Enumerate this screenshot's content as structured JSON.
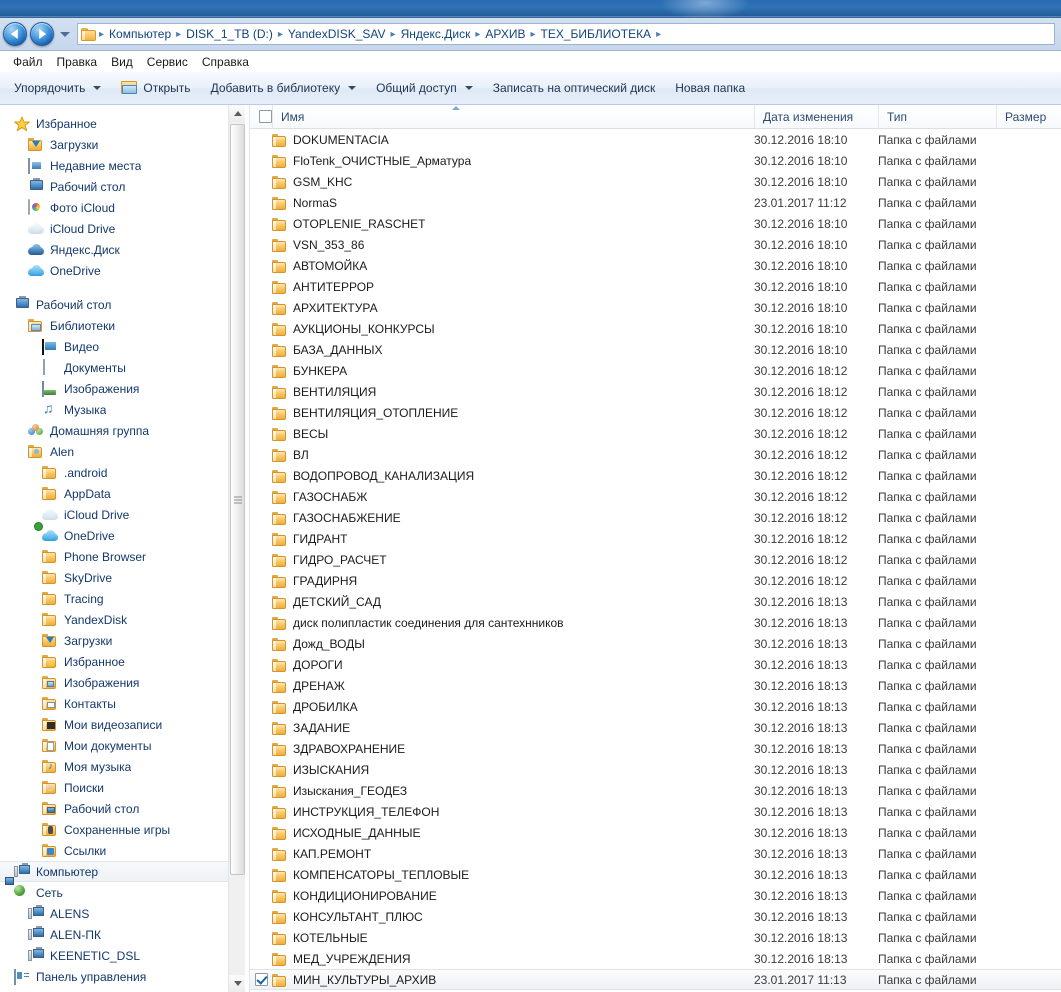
{
  "window": {
    "nav": {
      "back_tooltip": "Назад",
      "forward_tooltip": "Вперед",
      "history_tooltip": "Последние страницы"
    },
    "breadcrumb": [
      "Компьютер",
      "DISK_1_TB (D:)",
      "YandexDISK_SAV",
      "Яндекс.Диск",
      "АРХИВ",
      "ТЕХ_БИБЛИОТЕКА"
    ],
    "breadcrumb_separator": "▸"
  },
  "menubar": {
    "items": [
      {
        "label": "Файл"
      },
      {
        "label": "Правка"
      },
      {
        "label": "Вид"
      },
      {
        "label": "Сервис"
      },
      {
        "label": "Справка"
      }
    ]
  },
  "toolbar": {
    "buttons": [
      {
        "label": "Упорядочить",
        "icon": "none",
        "has_caret": true
      },
      {
        "label": "Открыть",
        "icon": "open-folder-icon",
        "has_caret": false
      },
      {
        "label": "Добавить в библиотеку",
        "icon": "none",
        "has_caret": true
      },
      {
        "label": "Общий доступ",
        "icon": "none",
        "has_caret": true
      },
      {
        "label": "Записать на оптический диск",
        "icon": "none",
        "has_caret": false
      },
      {
        "label": "Новая папка",
        "icon": "none",
        "has_caret": false
      }
    ]
  },
  "sidebar": {
    "items": [
      {
        "label": "Избранное",
        "icon": "star-icon",
        "indent": 0
      },
      {
        "label": "Загрузки",
        "icon": "downloads-icon",
        "indent": 1
      },
      {
        "label": "Недавние места",
        "icon": "recent-icon",
        "indent": 1
      },
      {
        "label": "Рабочий стол",
        "icon": "desktop-icon",
        "indent": 1
      },
      {
        "label": "Фото iCloud",
        "icon": "icloud-photo-icon",
        "indent": 1
      },
      {
        "label": "iCloud Drive",
        "icon": "cloud-gray-icon",
        "indent": 1
      },
      {
        "label": "Яндекс.Диск",
        "icon": "cloud-dark-icon",
        "indent": 1
      },
      {
        "label": "OneDrive",
        "icon": "cloud-icon",
        "indent": 1
      },
      {
        "label": "",
        "icon": "spacer",
        "indent": 0
      },
      {
        "label": "Рабочий стол",
        "icon": "desktop-icon",
        "indent": 0
      },
      {
        "label": "Библиотеки",
        "icon": "libraries-icon",
        "indent": 1
      },
      {
        "label": "Видео",
        "icon": "video-icon",
        "indent": 2
      },
      {
        "label": "Документы",
        "icon": "document-icon",
        "indent": 2
      },
      {
        "label": "Изображения",
        "icon": "picture-icon",
        "indent": 2
      },
      {
        "label": "Музыка",
        "icon": "music-icon",
        "indent": 2
      },
      {
        "label": "Домашняя группа",
        "icon": "homegroup-icon",
        "indent": 1
      },
      {
        "label": "Alen",
        "icon": "user-folder-icon",
        "indent": 1
      },
      {
        "label": ".android",
        "icon": "folder-icon",
        "indent": 2
      },
      {
        "label": "AppData",
        "icon": "folder-icon",
        "indent": 2
      },
      {
        "label": "iCloud Drive",
        "icon": "cloud-gray-icon",
        "indent": 2
      },
      {
        "label": "OneDrive",
        "icon": "onedrive-sync-icon",
        "indent": 2
      },
      {
        "label": "Phone Browser",
        "icon": "folder-icon",
        "indent": 2
      },
      {
        "label": "SkyDrive",
        "icon": "folder-icon",
        "indent": 2
      },
      {
        "label": "Tracing",
        "icon": "folder-icon",
        "indent": 2
      },
      {
        "label": "YandexDisk",
        "icon": "folder-icon",
        "indent": 2
      },
      {
        "label": "Загрузки",
        "icon": "downloads-icon",
        "indent": 2
      },
      {
        "label": "Избранное",
        "icon": "fav-folder-icon",
        "indent": 2
      },
      {
        "label": "Изображения",
        "icon": "pic-folder-icon",
        "indent": 2
      },
      {
        "label": "Контакты",
        "icon": "contacts-icon",
        "indent": 2
      },
      {
        "label": "Мои видеозаписи",
        "icon": "video-folder-icon",
        "indent": 2
      },
      {
        "label": "Мои документы",
        "icon": "doc-folder-icon",
        "indent": 2
      },
      {
        "label": "Моя музыка",
        "icon": "music-folder-icon",
        "indent": 2
      },
      {
        "label": "Поиски",
        "icon": "search-folder-icon",
        "indent": 2
      },
      {
        "label": "Рабочий стол",
        "icon": "desk-folder-icon",
        "indent": 2
      },
      {
        "label": "Сохраненные игры",
        "icon": "games-folder-icon",
        "indent": 2
      },
      {
        "label": "Ссылки",
        "icon": "links-folder-icon",
        "indent": 2
      },
      {
        "label": "Компьютер",
        "icon": "computer-icon",
        "indent": 0,
        "selected": true
      },
      {
        "label": "Сеть",
        "icon": "network-icon",
        "indent": 0
      },
      {
        "label": "ALENS",
        "icon": "computer-icon",
        "indent": 1
      },
      {
        "label": "ALEN-ПК",
        "icon": "computer-icon",
        "indent": 1
      },
      {
        "label": "KEENETIC_DSL",
        "icon": "computer-icon",
        "indent": 1
      },
      {
        "label": "Панель управления",
        "icon": "control-panel-icon",
        "indent": 0
      }
    ]
  },
  "filelist": {
    "columns": [
      {
        "key": "name",
        "label": "Имя",
        "sorted": true
      },
      {
        "key": "date",
        "label": "Дата изменения",
        "sorted": false
      },
      {
        "key": "type",
        "label": "Тип",
        "sorted": false
      },
      {
        "key": "size",
        "label": "Размер",
        "sorted": false
      }
    ],
    "folder_type_label": "Папка с файлами",
    "rows": [
      {
        "name": "DOKUMENTACIA",
        "date": "30.12.2016 18:10",
        "type": "Папка с файлами",
        "size": ""
      },
      {
        "name": "FloTenk_ОЧИСТНЫЕ_Арматура",
        "date": "30.12.2016 18:10",
        "type": "Папка с файлами",
        "size": ""
      },
      {
        "name": "GSM_KHC",
        "date": "30.12.2016 18:10",
        "type": "Папка с файлами",
        "size": ""
      },
      {
        "name": "NormaS",
        "date": "23.01.2017 11:12",
        "type": "Папка с файлами",
        "size": ""
      },
      {
        "name": "OTOPLENIE_RASCHET",
        "date": "30.12.2016 18:10",
        "type": "Папка с файлами",
        "size": ""
      },
      {
        "name": "VSN_353_86",
        "date": "30.12.2016 18:10",
        "type": "Папка с файлами",
        "size": ""
      },
      {
        "name": "АВТОМОЙКА",
        "date": "30.12.2016 18:10",
        "type": "Папка с файлами",
        "size": ""
      },
      {
        "name": "АНТИТЕРРОР",
        "date": "30.12.2016 18:10",
        "type": "Папка с файлами",
        "size": ""
      },
      {
        "name": "АРХИТЕКТУРА",
        "date": "30.12.2016 18:10",
        "type": "Папка с файлами",
        "size": ""
      },
      {
        "name": "АУКЦИОНЫ_КОНКУРСЫ",
        "date": "30.12.2016 18:10",
        "type": "Папка с файлами",
        "size": ""
      },
      {
        "name": "БАЗА_ДАННЫХ",
        "date": "30.12.2016 18:10",
        "type": "Папка с файлами",
        "size": ""
      },
      {
        "name": "БУНКЕРА",
        "date": "30.12.2016 18:12",
        "type": "Папка с файлами",
        "size": ""
      },
      {
        "name": "ВЕНТИЛЯЦИЯ",
        "date": "30.12.2016 18:12",
        "type": "Папка с файлами",
        "size": ""
      },
      {
        "name": "ВЕНТИЛЯЦИЯ_ОТОПЛЕНИЕ",
        "date": "30.12.2016 18:12",
        "type": "Папка с файлами",
        "size": ""
      },
      {
        "name": "ВЕСЫ",
        "date": "30.12.2016 18:12",
        "type": "Папка с файлами",
        "size": ""
      },
      {
        "name": "ВЛ",
        "date": "30.12.2016 18:12",
        "type": "Папка с файлами",
        "size": ""
      },
      {
        "name": "ВОДОПРОВОД_КАНАЛИЗАЦИЯ",
        "date": "30.12.2016 18:12",
        "type": "Папка с файлами",
        "size": ""
      },
      {
        "name": "ГАЗОСНАБЖ",
        "date": "30.12.2016 18:12",
        "type": "Папка с файлами",
        "size": ""
      },
      {
        "name": "ГАЗОСНАБЖЕНИЕ",
        "date": "30.12.2016 18:12",
        "type": "Папка с файлами",
        "size": ""
      },
      {
        "name": "ГИДРАНТ",
        "date": "30.12.2016 18:12",
        "type": "Папка с файлами",
        "size": ""
      },
      {
        "name": "ГИДРО_РАСЧЕТ",
        "date": "30.12.2016 18:12",
        "type": "Папка с файлами",
        "size": ""
      },
      {
        "name": "ГРАДИРНЯ",
        "date": "30.12.2016 18:12",
        "type": "Папка с файлами",
        "size": ""
      },
      {
        "name": "ДЕТСКИЙ_САД",
        "date": "30.12.2016 18:13",
        "type": "Папка с файлами",
        "size": ""
      },
      {
        "name": "диск полипластик соединения для сантехнников",
        "date": "30.12.2016 18:13",
        "type": "Папка с файлами",
        "size": ""
      },
      {
        "name": "Дожд_ВОДЫ",
        "date": "30.12.2016 18:13",
        "type": "Папка с файлами",
        "size": ""
      },
      {
        "name": "ДОРОГИ",
        "date": "30.12.2016 18:13",
        "type": "Папка с файлами",
        "size": ""
      },
      {
        "name": "ДРЕНАЖ",
        "date": "30.12.2016 18:13",
        "type": "Папка с файлами",
        "size": ""
      },
      {
        "name": "ДРОБИЛКА",
        "date": "30.12.2016 18:13",
        "type": "Папка с файлами",
        "size": ""
      },
      {
        "name": "ЗАДАНИЕ",
        "date": "30.12.2016 18:13",
        "type": "Папка с файлами",
        "size": ""
      },
      {
        "name": "ЗДРАВОХРАНЕНИЕ",
        "date": "30.12.2016 18:13",
        "type": "Папка с файлами",
        "size": ""
      },
      {
        "name": "ИЗЫСКАНИЯ",
        "date": "30.12.2016 18:13",
        "type": "Папка с файлами",
        "size": ""
      },
      {
        "name": "Изыскания_ГЕОДЕЗ",
        "date": "30.12.2016 18:13",
        "type": "Папка с файлами",
        "size": ""
      },
      {
        "name": "ИНСТРУКЦИЯ_ТЕЛЕФОН",
        "date": "30.12.2016 18:13",
        "type": "Папка с файлами",
        "size": ""
      },
      {
        "name": "ИСХОДНЫЕ_ДАННЫЕ",
        "date": "30.12.2016 18:13",
        "type": "Папка с файлами",
        "size": ""
      },
      {
        "name": "КАП.РЕМОНТ",
        "date": "30.12.2016 18:13",
        "type": "Папка с файлами",
        "size": ""
      },
      {
        "name": "КОМПЕНСАТОРЫ_ТЕПЛОВЫЕ",
        "date": "30.12.2016 18:13",
        "type": "Папка с файлами",
        "size": ""
      },
      {
        "name": "КОНДИЦИОНИРОВАНИЕ",
        "date": "30.12.2016 18:13",
        "type": "Папка с файлами",
        "size": ""
      },
      {
        "name": "КОНСУЛЬТАНТ_ПЛЮС",
        "date": "30.12.2016 18:13",
        "type": "Папка с файлами",
        "size": ""
      },
      {
        "name": "КОТЕЛЬНЫЕ",
        "date": "30.12.2016 18:13",
        "type": "Папка с файлами",
        "size": ""
      },
      {
        "name": "МЕД_УЧРЕЖДЕНИЯ",
        "date": "30.12.2016 18:13",
        "type": "Папка с файлами",
        "size": ""
      },
      {
        "name": "МИН_КУЛЬТУРЫ_АРХИВ",
        "date": "23.01.2017 11:13",
        "type": "Папка с файлами",
        "size": "",
        "selected": true
      }
    ]
  },
  "colors": {
    "titlebar": "#2a6bb0",
    "address_text": "#11457e",
    "sidebar_text": "#13386b",
    "folder_gold": "#f0b445",
    "selection": "#eef1f5"
  }
}
